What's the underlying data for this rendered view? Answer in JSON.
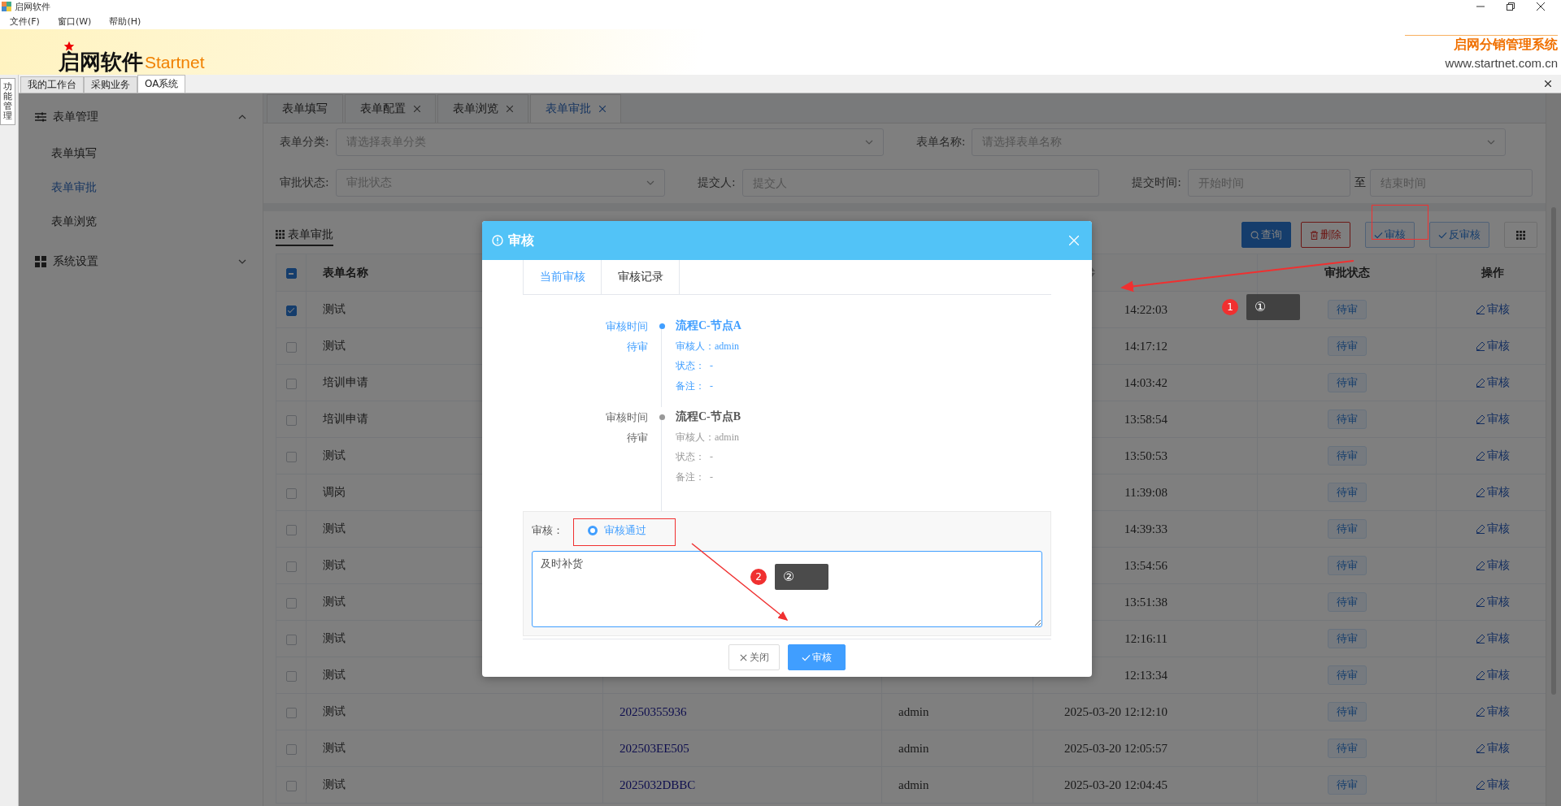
{
  "window": {
    "title": "启网软件"
  },
  "menu": [
    "文件(F)",
    "窗口(W)",
    "帮助(H)"
  ],
  "banner": {
    "logo": "启网软件",
    "logo_latin": "Startnet",
    "system_name": "启网分销管理系统",
    "website": "www.startnet.com.cn"
  },
  "side_strip": {
    "label": "功能管理"
  },
  "top_tabs": [
    {
      "label": "我的工作台",
      "selected": false
    },
    {
      "label": "采购业务",
      "selected": false
    },
    {
      "label": "OA系统",
      "selected": true
    }
  ],
  "sidebar": [
    {
      "label": "表单管理",
      "expanded": true,
      "children": [
        {
          "label": "表单填写",
          "selected": false
        },
        {
          "label": "表单审批",
          "selected": true
        },
        {
          "label": "表单浏览",
          "selected": false
        }
      ]
    },
    {
      "label": "系统设置",
      "expanded": false
    }
  ],
  "page_tabs": [
    {
      "label": "表单填写",
      "closable": false,
      "selected": false
    },
    {
      "label": "表单配置",
      "closable": true,
      "selected": false
    },
    {
      "label": "表单浏览",
      "closable": true,
      "selected": false
    },
    {
      "label": "表单审批",
      "closable": true,
      "selected": true
    }
  ],
  "filters": [
    {
      "kind": "select",
      "label": "表单分类:",
      "placeholder": "请选择表单分类"
    },
    {
      "kind": "select",
      "label": "表单名称:",
      "placeholder": "请选择表单名称"
    },
    {
      "kind": "select",
      "label": "审批状态:",
      "placeholder": "审批状态"
    },
    {
      "kind": "input",
      "label": "提交人:",
      "placeholder": "提交人"
    },
    {
      "kind": "range",
      "label": "提交时间:",
      "placeholder": "开始时间",
      "separator": "至",
      "placeholder_end": "结束时间"
    }
  ],
  "panel": {
    "title": "表单审批"
  },
  "toolbar": [
    {
      "kind": "primary",
      "label": "查询"
    },
    {
      "kind": "danger",
      "label": "删除"
    },
    {
      "kind": "plain",
      "label": "审核"
    },
    {
      "kind": "plain",
      "label": "反审核"
    },
    {
      "kind": "icon"
    }
  ],
  "table": {
    "header_checkbox": {
      "indeterminate": true
    },
    "columns": {
      "name": "表单名称",
      "status": "审批状态",
      "action": "操作"
    },
    "rows": [
      {
        "checked": true,
        "name": "测试",
        "time": "14:22:03",
        "status": "待审",
        "action": "审核"
      },
      {
        "checked": false,
        "name": "测试",
        "time": "14:17:12",
        "status": "待审",
        "action": "审核"
      },
      {
        "checked": false,
        "name": "培训申请",
        "time": "14:03:42",
        "status": "待审",
        "action": "审核"
      },
      {
        "checked": false,
        "name": "培训申请",
        "time": "13:58:54",
        "status": "待审",
        "action": "审核"
      },
      {
        "checked": false,
        "name": "测试",
        "time": "13:50:53",
        "status": "待审",
        "action": "审核"
      },
      {
        "checked": false,
        "name": "调岗",
        "time": "11:39:08",
        "status": "待审",
        "action": "审核"
      },
      {
        "checked": false,
        "name": "测试",
        "time": "14:39:33",
        "status": "待审",
        "action": "审核"
      },
      {
        "checked": false,
        "name": "测试",
        "time": "13:54:56",
        "status": "待审",
        "action": "审核"
      },
      {
        "checked": false,
        "name": "测试",
        "time": "13:51:38",
        "status": "待审",
        "action": "审核"
      },
      {
        "checked": false,
        "name": "测试",
        "time": "12:16:11",
        "status": "待审",
        "action": "审核"
      },
      {
        "checked": false,
        "name": "测试",
        "time": "12:13:34",
        "status": "待审",
        "action": "审核"
      },
      {
        "checked": false,
        "name": "测试",
        "number": "20250355936",
        "submitter": "admin",
        "time": "2025-03-20 12:12:10",
        "status": "待审",
        "action": "审核"
      },
      {
        "checked": false,
        "name": "测试",
        "number": "202503EE505",
        "submitter": "admin",
        "time": "2025-03-20 12:05:57",
        "status": "待审",
        "action": "审核"
      },
      {
        "checked": false,
        "name": "测试",
        "number": "2025032DBBC",
        "submitter": "admin",
        "time": "2025-03-20 12:04:45",
        "status": "待审",
        "action": "审核"
      }
    ]
  },
  "dialog": {
    "title": "审核",
    "tabs": [
      {
        "label": "当前审核",
        "selected": true
      },
      {
        "label": "审核记录",
        "selected": false
      }
    ],
    "timeline": [
      {
        "time_label": "审核时间",
        "status": "待审",
        "title": "流程C-节点A",
        "active": true,
        "fields": [
          "审核人：admin",
          "状态：  -",
          "备注：  -"
        ]
      },
      {
        "time_label": "审核时间",
        "status": "待审",
        "title": "流程C-节点B",
        "active": false,
        "fields": [
          "审核人：admin",
          "状态：  -",
          "备注：  -"
        ]
      }
    ],
    "review": {
      "label": "审核：",
      "options": [
        {
          "label": "审核通过",
          "selected": true
        }
      ],
      "comment": "及时补货"
    },
    "buttons": [
      {
        "kind": "default",
        "label": "关闭"
      },
      {
        "kind": "primary",
        "label": "审核"
      }
    ]
  },
  "annotations": [
    {
      "number": "1",
      "tooltip": "①"
    },
    {
      "number": "2",
      "tooltip": "②"
    }
  ]
}
